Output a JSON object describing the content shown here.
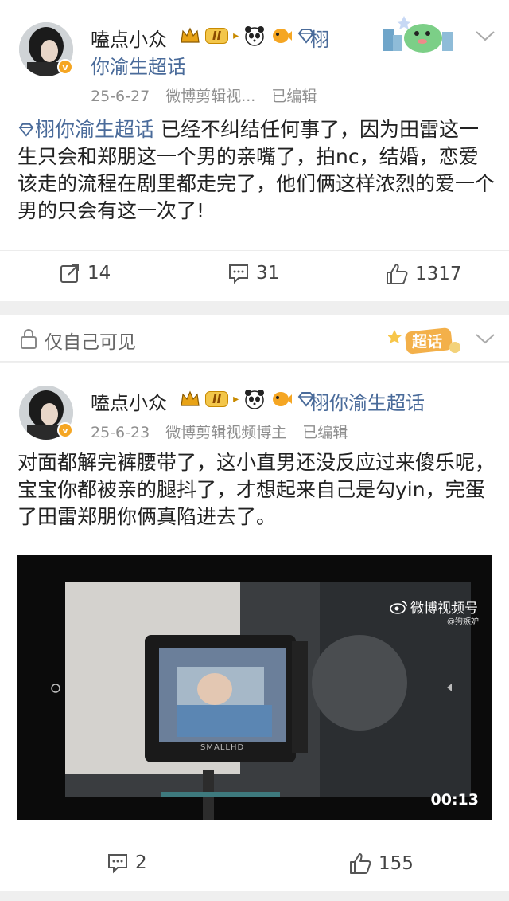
{
  "post1": {
    "username": "嗑点小众",
    "level_badge": "II",
    "topic_tag_line1": "栩",
    "topic_tag_line2": "你渝生超话",
    "date": "25-6-27",
    "source": "微博剪辑视...",
    "edited": "已编辑",
    "body_topic": "栩你渝生超话",
    "body_text": " 已经不纠结任何事了，因为田雷这一生只会和郑朋这一个男的亲嘴了，拍nc，结婚，恋爱该走的流程在剧里都走完了，他们俩这样浓烈的爱一个男的只会有这一次了!",
    "repost_count": "14",
    "comment_count": "31",
    "like_count": "1317"
  },
  "privacy_bar": {
    "label": "仅自己可见",
    "supertopic_badge": "超话"
  },
  "post2": {
    "username": "嗑点小众",
    "level_badge": "II",
    "topic_tag": "栩你渝生超话",
    "date": "25-6-23",
    "source": "微博剪辑视频博主",
    "edited": "已编辑",
    "body_text": "对面都解完裤腰带了，这小直男还没反应过来傻乐呢，宝宝你都被亲的腿抖了，才想起来自己是勾yin，完蛋了田雷郑朋你俩真陷进去了。",
    "video": {
      "watermark": "微博视频号",
      "watermark_handle": "@狗嫉妒",
      "monitor_brand": "SMALLHD",
      "duration": "00:13"
    },
    "comment_count": "2",
    "like_count": "155"
  },
  "colors": {
    "topic_blue": "#4a6b9a",
    "verified_orange": "#f5a623",
    "level_gold": "#e8a317"
  }
}
